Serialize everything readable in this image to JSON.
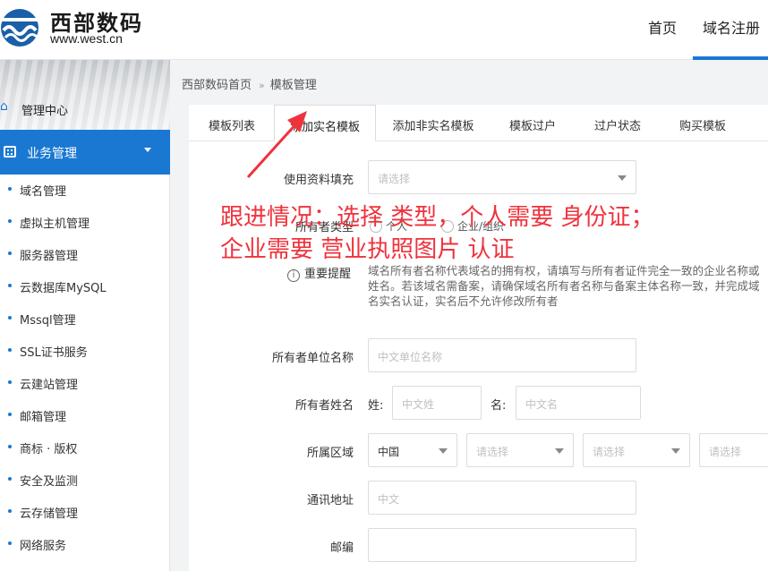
{
  "header": {
    "brand_cn": "西部数码",
    "brand_url": "www.west.cn",
    "nav": [
      "首页",
      "域名注册"
    ],
    "accent": "#1a78d2"
  },
  "sidebar": {
    "manage_center": "管理中心",
    "business": "业务管理",
    "items": [
      "域名管理",
      "虚拟主机管理",
      "服务器管理",
      "云数据库MySQL",
      "Mssql管理",
      "SSL证书服务",
      "云建站管理",
      "邮箱管理",
      "商标 · 版权",
      "安全及监测",
      "云存储管理",
      "网络服务"
    ]
  },
  "breadcrumb": [
    "西部数码首页",
    "模板管理"
  ],
  "tabs": [
    "模板列表",
    "添加实名模板",
    "添加非实名模板",
    "模板过户",
    "过户状态",
    "购买模板"
  ],
  "active_tab": "添加实名模板",
  "form": {
    "fill_label": "使用资料填充",
    "fill_placeholder": "请选择",
    "owner_type_label": "所有者类型",
    "owner_type_options": [
      "个人",
      "企业/组织"
    ],
    "notice_label": "重要提醒",
    "notice_text": "域名所有者名称代表域名的拥有权，请填写与所有者证件完全一致的企业名称或姓名。若该域名需备案，请确保域名所有者名称与备案主体名称一致，并完成域名实名认证，实名后不允许修改所有者",
    "org_label": "所有者单位名称",
    "org_placeholder": "中文单位名称",
    "name_label": "所有者姓名",
    "surname_label": "姓:",
    "surname_placeholder": "中文姓",
    "given_label": "名:",
    "given_placeholder": "中文名",
    "region_label": "所属区域",
    "region_country": "中国",
    "region_placeholders": [
      "请选择",
      "请选择",
      "请选择"
    ],
    "address_label": "通讯地址",
    "address_placeholder": "中文",
    "zip_label": "邮编"
  },
  "annotation": {
    "line1": "跟进情况：选择 类型，个人需要 身份证；",
    "line2": "企业需要 营业执照图片 认证",
    "color": "#f0323c"
  }
}
